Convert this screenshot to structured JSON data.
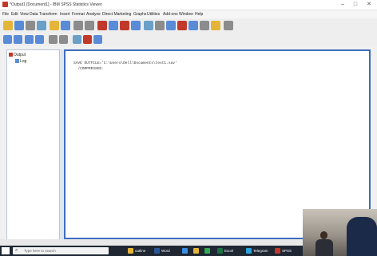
{
  "window": {
    "title": "*Output1 [Document1] - IBM SPSS Statistics Viewer",
    "controls": {
      "minimize": "–",
      "maximize": "□",
      "close": "✕"
    }
  },
  "menu": [
    "File",
    "Edit",
    "View",
    "Data",
    "Transform",
    "Insert",
    "Format",
    "Analyze",
    "Direct Marketing",
    "Graphs",
    "Utilities",
    "Add-ons",
    "Window",
    "Help"
  ],
  "outline": {
    "root_label": "Output",
    "child_label": "Log"
  },
  "syntax": {
    "line1": "SAVE OUTFILE='C:\\Users\\Dell\\Documents\\test1.sav'",
    "line2": "  /COMPRESSED."
  },
  "taskbar": {
    "search_placeholder": "Type here to search",
    "apps": [
      "outline",
      "Word",
      "",
      "",
      "",
      "Excel",
      "Telegram",
      "SPSS"
    ]
  },
  "colors": {
    "accent": "#3f6dbd",
    "toolbar_red": "#c0392b",
    "toolbar_yellow": "#e5b53a",
    "toolbar_blue": "#5a8bd6",
    "toolbar_grey": "#8c8c8c"
  }
}
